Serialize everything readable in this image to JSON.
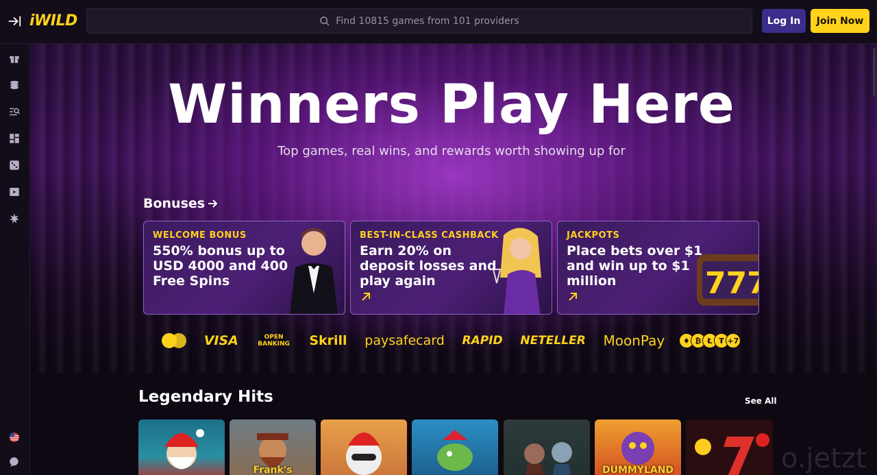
{
  "header": {
    "logo": "iWILD",
    "search_placeholder": "Find 10815 games from 101 providers",
    "login_label": "Log In",
    "join_label": "Join Now"
  },
  "sidebar": {
    "icons": [
      "gift-icon",
      "coins-icon",
      "search-list-icon",
      "dashboard-icon",
      "dice-icon",
      "video-icon",
      "spark-icon"
    ],
    "bottom_icons": [
      "us-flag-icon",
      "chat-icon"
    ]
  },
  "hero": {
    "title": "Winners Play Here",
    "subtitle": "Top games, real wins, and rewards worth showing up for"
  },
  "bonuses": {
    "heading": "Bonuses",
    "cards": [
      {
        "tag": "WELCOME BONUS",
        "text": "550% bonus up to USD 4000 and 400 Free Spins"
      },
      {
        "tag": "BEST-IN-CLASS CASHBACK",
        "text": "Earn 20% on deposit losses and play again"
      },
      {
        "tag": "JACKPOTS",
        "text": "Place bets over $1 and win up to $1 million"
      }
    ]
  },
  "payments": {
    "visa": "VISA",
    "open_banking": "OPEN BANKING",
    "skrill": "Skrill",
    "paysafecard": "paysafecard",
    "rapid": "RAPID",
    "neteller": "NETELLER",
    "moonpay": "MoonPay",
    "crypto_more": "+7"
  },
  "legendary": {
    "title": "Legendary Hits",
    "see_all": "See All",
    "tiles": [
      "",
      "Frank's",
      "",
      "",
      "",
      "DUMMYLAND",
      ""
    ]
  },
  "watermark": "o.jetzt",
  "colors": {
    "accent": "#ffd21c",
    "login": "#3b2d8a",
    "background": "#0d0812"
  }
}
